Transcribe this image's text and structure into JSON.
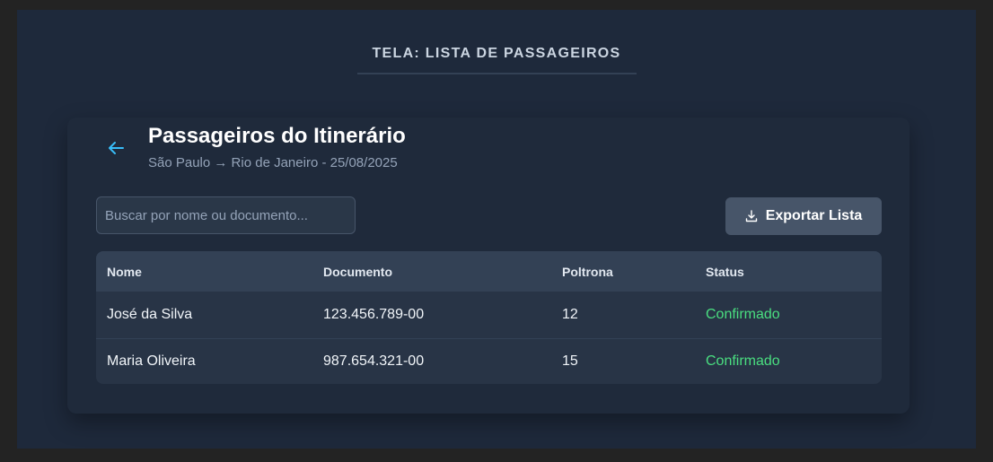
{
  "screen_title": "TELA: LISTA DE PASSAGEIROS",
  "header": {
    "title": "Passageiros do Itinerário",
    "subtitle": "São Paulo → Rio de Janeiro - 25/08/2025",
    "back_icon": "arrow-left-icon"
  },
  "toolbar": {
    "search_placeholder": "Buscar por nome ou documento...",
    "search_value": "",
    "export_label": "Exportar Lista",
    "export_icon": "download-icon"
  },
  "table": {
    "columns": [
      "Nome",
      "Documento",
      "Poltrona",
      "Status"
    ],
    "rows": [
      {
        "nome": "José da Silva",
        "documento": "123.456.789-00",
        "poltrona": "12",
        "status": "Confirmado"
      },
      {
        "nome": "Maria Oliveira",
        "documento": "987.654.321-00",
        "poltrona": "15",
        "status": "Confirmado"
      }
    ]
  },
  "colors": {
    "accent": "#38bdf8",
    "status_confirmed": "#4ade80"
  }
}
